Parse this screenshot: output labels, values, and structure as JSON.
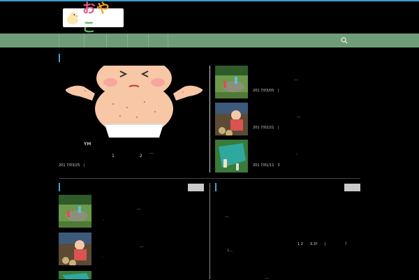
{
  "site": {
    "logo_text": "おやこ",
    "logo_icon": "chick-icon"
  },
  "nav": {
    "items_count": 6,
    "search_icon": "search-icon"
  },
  "featured": {
    "category": "YM",
    "title": "1　　2",
    "ellipsis": "...",
    "date": "201 7/03/25　|"
  },
  "side_posts": [
    {
      "date": "201 7/03/05　|",
      "ellipsis": "..."
    },
    {
      "date": "201 7/02/21　|",
      "ellipsis": "..."
    },
    {
      "date": "201 7/01/11　3",
      "ellipsis": "."
    }
  ],
  "left_list": [
    {
      "ellipsis": "...",
      "mark": "."
    },
    {
      "ellipsis": "...",
      "mark": "."
    }
  ],
  "right_block": {
    "ellipsis1": "...",
    "numbers": "1 2　　3.3?　　(",
    "bracket": "(…",
    "paren_end": ")",
    "bottom": "..."
  }
}
